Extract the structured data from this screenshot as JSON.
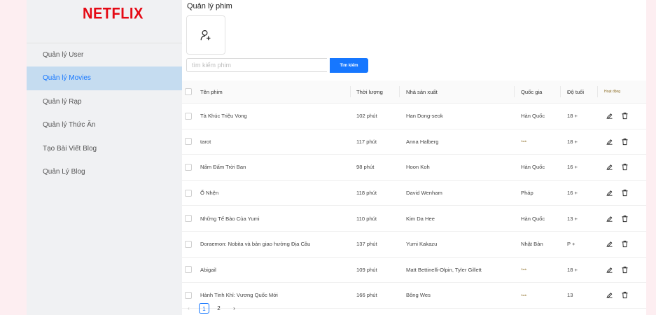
{
  "app": {
    "logo": "NETFLIX"
  },
  "sidebar": {
    "items": [
      {
        "label": "Quản lý User",
        "active": false
      },
      {
        "label": "Quản lý Movies",
        "active": true
      },
      {
        "label": "Quản lý Rạp",
        "active": false
      },
      {
        "label": "Quản lý Thức Ăn",
        "active": false
      },
      {
        "label": "Tạo Bài Viết Blog",
        "active": false
      },
      {
        "label": "Quản Lý Blog",
        "active": false
      }
    ]
  },
  "main": {
    "title": "Quản lý phim",
    "add_button_icon": "user-add-icon",
    "search": {
      "placeholder": "tìm kiếm phim",
      "value": "",
      "button_label": "Tìm kiếm"
    },
    "table": {
      "headers": {
        "name": "Tên phim",
        "duration": "Thời lượng",
        "producer": "Nhà sản xuất",
        "country": "Quốc gia",
        "age": "Độ tuổi",
        "actions": "Hoạt động"
      },
      "rows": [
        {
          "name": "Tà Khúc Triệu Vong",
          "duration": "102 phút",
          "producer": "Han Dong-seok",
          "country": "Hàn Quốc",
          "age": "18 +"
        },
        {
          "name": "tarot",
          "duration": "117 phút",
          "producer": "Anna Halberg",
          "country": "Canh",
          "age": "18 +"
        },
        {
          "name": "Nấm Đấm Trời Ban",
          "duration": "98 phút",
          "producer": "Hoon Koh",
          "country": "Hàn Quốc",
          "age": "16 +"
        },
        {
          "name": "Ổ Nhện",
          "duration": "118 phút",
          "producer": "David Wenham",
          "country": "Pháp",
          "age": "16 +"
        },
        {
          "name": "Những Tế Bào Của Yumi",
          "duration": "110 phút",
          "producer": "Kim Da Hee",
          "country": "Hàn Quốc",
          "age": "13 +"
        },
        {
          "name": "Doraemon: Nobita và bản giao hưởng Địa Cầu",
          "duration": "137 phút",
          "producer": "Yumi Kakazu",
          "country": "Nhật Bản",
          "age": "P +"
        },
        {
          "name": "Abigail",
          "duration": "109 phút",
          "producer": "Matt Bettinelli-Olpin, Tyler Gillett",
          "country": "Canh",
          "age": "18 +"
        },
        {
          "name": "Hành Tinh Khỉ: Vương Quốc Mới",
          "duration": "166 phút",
          "producer": "Bông Wes",
          "country": "Canh",
          "age": "13"
        }
      ]
    },
    "pagination": {
      "prev": "‹",
      "pages": [
        "1",
        "2"
      ],
      "current": "1",
      "next": "›"
    }
  },
  "colors": {
    "brand": "#e50914",
    "accent": "#1677ff",
    "active_nav_bg": "#c5dcf0"
  }
}
